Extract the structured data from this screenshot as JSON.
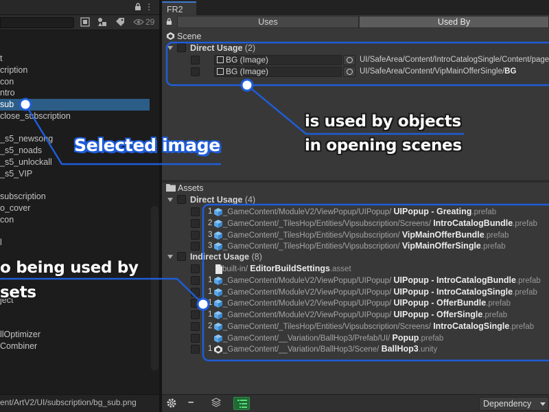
{
  "left_panel": {
    "count": "29",
    "items": [
      {
        "label": "t"
      },
      {
        "label": "cription"
      },
      {
        "label": "con"
      },
      {
        "label": "ntro"
      },
      {
        "label": "sub",
        "selected": true
      },
      {
        "label": "close_subscription"
      },
      {
        "label": ""
      },
      {
        "label": "_s5_newsong"
      },
      {
        "label": "_s5_noads"
      },
      {
        "label": "_s5_unlockall"
      },
      {
        "label": "_s5_VIP"
      },
      {
        "label": ""
      },
      {
        "label": "subscription"
      },
      {
        "label": "o_cover"
      },
      {
        "label": "con"
      },
      {
        "label": ""
      },
      {
        "label": "l"
      },
      {
        "label": ""
      },
      {
        "label": ""
      },
      {
        "label": ""
      },
      {
        "label": ""
      },
      {
        "label": "ject"
      },
      {
        "label": ""
      },
      {
        "label": ""
      },
      {
        "label": "llOptimizer"
      },
      {
        "label": "Combiner"
      }
    ],
    "bottom_path": "ent/ArtV2/UI/subscription/bg_sub.png"
  },
  "fr2": {
    "tab": "FR2",
    "uses_label": "Uses",
    "used_by_label": "Used By",
    "scene_header": "Scene",
    "scene_group": {
      "label": "Direct Usage",
      "count": "(2)"
    },
    "scene_rows": [
      {
        "field": "BG (Image)",
        "path": "UI/SafeArea/Content/IntroCatalogSingle/Content/page",
        "path_bold": ""
      },
      {
        "field": "BG (Image)",
        "path": "UI/SafeArea/Content/VipMainOfferSingle/",
        "path_bold": "BG"
      }
    ],
    "assets_header": "Assets",
    "direct_group": {
      "label": "Direct Usage",
      "count": "(4)"
    },
    "direct_rows": [
      {
        "num": "1",
        "icon": "prefab-cube-icon",
        "path": "_GameContent/ModuleV2/ViewPopup/UIPopup/",
        "name": "UIPopup - Greating",
        "ext": ".prefab"
      },
      {
        "num": "2",
        "icon": "prefab-cube-icon",
        "path": "_GameContent/_TilesHop/Entities/Vipsubscription/Screens/",
        "name": "IntroCatalogBundle",
        "ext": ".prefab"
      },
      {
        "num": "3",
        "icon": "prefab-cube-icon",
        "path": "_GameContent/_TilesHop/Entities/Vipsubscription/",
        "name": "VipMainOfferBundle",
        "ext": ".prefab"
      },
      {
        "num": "3",
        "icon": "prefab-cube-icon",
        "path": "_GameContent/_TilesHop/Entities/Vipsubscription/",
        "name": "VipMainOfferSingle",
        "ext": ".prefab"
      }
    ],
    "indirect_group": {
      "label": "Indirect Usage",
      "count": "(8)"
    },
    "indirect_rows": [
      {
        "num": "",
        "icon": "file-icon",
        "path": "built-in/",
        "name": "EditorBuildSettings",
        "ext": ".asset"
      },
      {
        "num": "1",
        "icon": "prefab-cube-icon",
        "path": "_GameContent/ModuleV2/ViewPopup/UIPopup/",
        "name": "UIPopup - IntroCatalogBundle",
        "ext": ".prefab"
      },
      {
        "num": "1",
        "icon": "prefab-cube-icon",
        "path": "_GameContent/ModuleV2/ViewPopup/UIPopup/",
        "name": "UIPopup - IntroCatalogSingle",
        "ext": ".prefab"
      },
      {
        "num": "1",
        "icon": "prefab-cube-icon",
        "path": "_GameContent/ModuleV2/ViewPopup/UIPopup/",
        "name": "UIPopup - OfferBundle",
        "ext": ".prefab"
      },
      {
        "num": "1",
        "icon": "prefab-cube-icon",
        "path": "_GameContent/ModuleV2/ViewPopup/UIPopup/",
        "name": "UIPopup - OfferSingle",
        "ext": ".prefab"
      },
      {
        "num": "2",
        "icon": "prefab-cube-icon",
        "path": "_GameContent/_TilesHop/Entities/Vipsubscription/Screens/",
        "name": "IntroCatalogSingle",
        "ext": ".prefab"
      },
      {
        "num": "",
        "icon": "prefab-cube-icon",
        "path": "_GameContent/__Variation/BallHop3/Prefab/UI/",
        "name": "Popup",
        "ext": ".prefab"
      },
      {
        "num": "1",
        "icon": "unity-scene-icon",
        "path": "_GameContent/__Variation/BallHop3/Scene/",
        "name": "BallHop3",
        "ext": ".unity"
      }
    ],
    "dependency_label": "Dependency"
  },
  "callouts": {
    "selected": "Selected image",
    "scene_line1": "is used by objects",
    "scene_line2": "in opening scenes",
    "assets_line1": "o being used by",
    "assets_line2": "sets"
  },
  "colors": {
    "accent": "#1f5dd8",
    "selection": "#2c5d87",
    "prefab_icon": "#5aa6e6"
  }
}
